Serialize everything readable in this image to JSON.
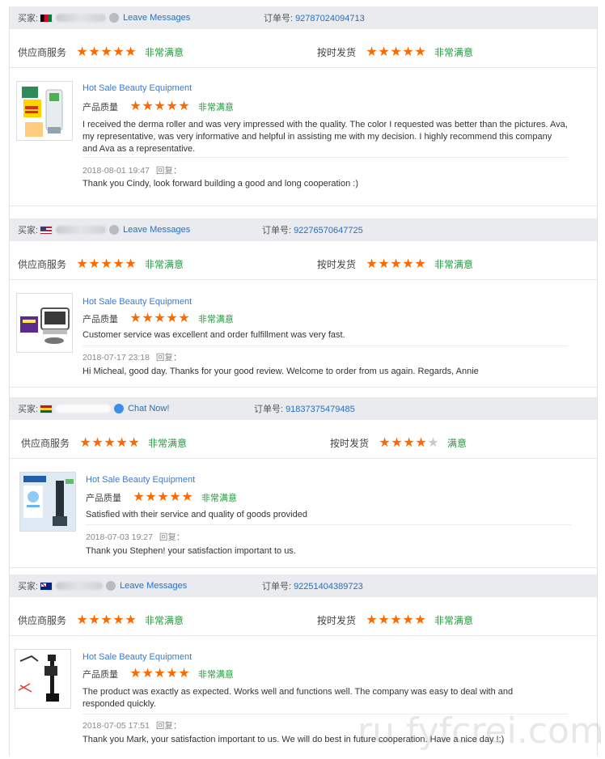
{
  "labels": {
    "buyer": "买家:",
    "order": "订单号:",
    "supplier_service": "供应商服务",
    "on_time": "按时发货",
    "quality": "产品质量",
    "reply": "回复："
  },
  "reviews": [
    {
      "flag_colors": [
        "#000000",
        "#e4002b",
        "#007a36"
      ],
      "message_label": "Leave Messages",
      "message_icon": "grey",
      "order_no": "92787024094713",
      "supplier_stars": 5,
      "supplier_level": "非常满意",
      "ship_stars": 5,
      "ship_level": "非常满意",
      "product": "Hot Sale Beauty Equipment",
      "quality_stars": 5,
      "quality_level": "非常满意",
      "text": "I received the derma roller and was very impressed with the quality. The color I requested was better than the pictures. Ava, my representative, was very informative and helpful in assisting me with my decision. I highly recommend this company and Ava as a representative.",
      "date": "2018-08-01 19:47",
      "reply": "Thank you Cindy, look forward building a good and long cooperation :)"
    },
    {
      "flag_colors": [
        "#b22234",
        "#ffffff",
        "#3c3b6e"
      ],
      "message_label": "Leave Messages",
      "message_icon": "grey",
      "order_no": "92276570647725",
      "supplier_stars": 5,
      "supplier_level": "非常满意",
      "ship_stars": 5,
      "ship_level": "非常满意",
      "product": "Hot Sale Beauty Equipment",
      "quality_stars": 5,
      "quality_level": "非常满意",
      "text": "Customer service was excellent and order fulfillment was very fast.",
      "date": "2018-07-17 23:18",
      "reply": "Hi Micheal, good day. Thanks for your good review. Welcome to order from us again. Regards, Annie"
    },
    {
      "flag_colors": [
        "#ce1126",
        "#fcd116",
        "#006b3f"
      ],
      "message_label": "Chat Now!",
      "message_icon": "blue",
      "order_no": "91837375479485",
      "supplier_stars": 5,
      "supplier_level": "非常满意",
      "ship_stars": 4,
      "ship_level": "满意",
      "product": "Hot Sale Beauty Equipment",
      "quality_stars": 5,
      "quality_level": "非常满意",
      "text": "Satisfied with their service and quality of goods provided",
      "date": "2018-07-03 19:27",
      "reply": "Thank you Stephen! your satisfaction important to us."
    },
    {
      "flag_colors": [
        "#00247d",
        "#cf142b",
        "#ffffff"
      ],
      "message_label": "Leave Messages",
      "message_icon": "grey",
      "order_no": "92251404389723",
      "supplier_stars": 5,
      "supplier_level": "非常满意",
      "ship_stars": 5,
      "ship_level": "非常满意",
      "product": "Hot Sale Beauty Equipment",
      "quality_stars": 5,
      "quality_level": "非常满意",
      "text": "The product was exactly as expected. Works well and functions well. The company was easy to deal with and responded quickly.",
      "date": "2018-07-05 17:51",
      "reply": "Thank you Mark, your satisfaction important to us. We will do best in future cooperation. Have a nice day !:)"
    }
  ],
  "watermark": "ru.fyfcrei.com"
}
